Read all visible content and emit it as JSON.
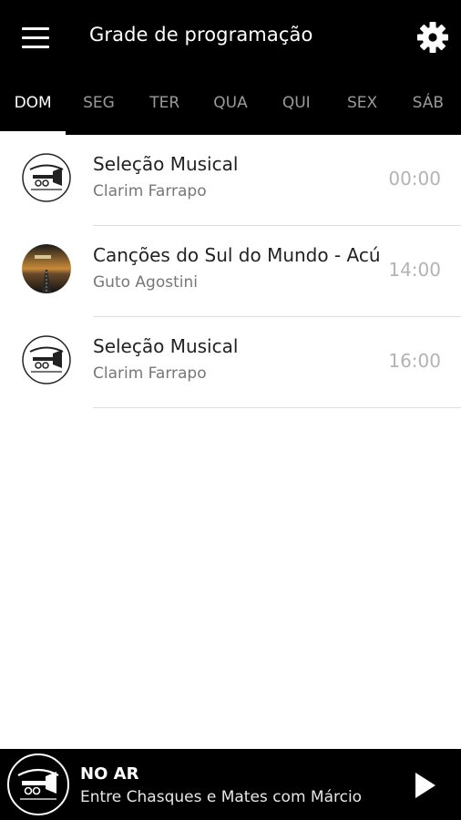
{
  "header": {
    "title": "Grade de programação",
    "menu_icon": "hamburger-menu-icon",
    "settings_icon": "gear-icon"
  },
  "tabs": [
    {
      "label": "DOM",
      "active": true
    },
    {
      "label": "SEG",
      "active": false
    },
    {
      "label": "TER",
      "active": false
    },
    {
      "label": "QUA",
      "active": false
    },
    {
      "label": "QUI",
      "active": false
    },
    {
      "label": "SEX",
      "active": false
    },
    {
      "label": "SÁB",
      "active": false
    }
  ],
  "schedule": [
    {
      "title": "Seleção Musical",
      "host": "Clarim Farrapo",
      "time": "00:00",
      "avatar": "clarim-farrapo-logo"
    },
    {
      "title": "Canções do Sul do Mundo - Acústico",
      "host": "Guto Agostini",
      "time": "14:00",
      "avatar": "road-sunset-photo"
    },
    {
      "title": "Seleção Musical",
      "host": "Clarim Farrapo",
      "time": "16:00",
      "avatar": "clarim-farrapo-logo"
    }
  ],
  "player": {
    "label": "NO AR",
    "now_playing": "Entre Chasques e Mates com Márcio",
    "logo_icon": "clarim-farrapo-logo",
    "play_icon": "play-icon"
  },
  "colors": {
    "appbar_bg": "#000000",
    "tab_inactive": "#9a9a9a",
    "tab_active": "#ffffff",
    "time_text": "#b3b3b3"
  }
}
